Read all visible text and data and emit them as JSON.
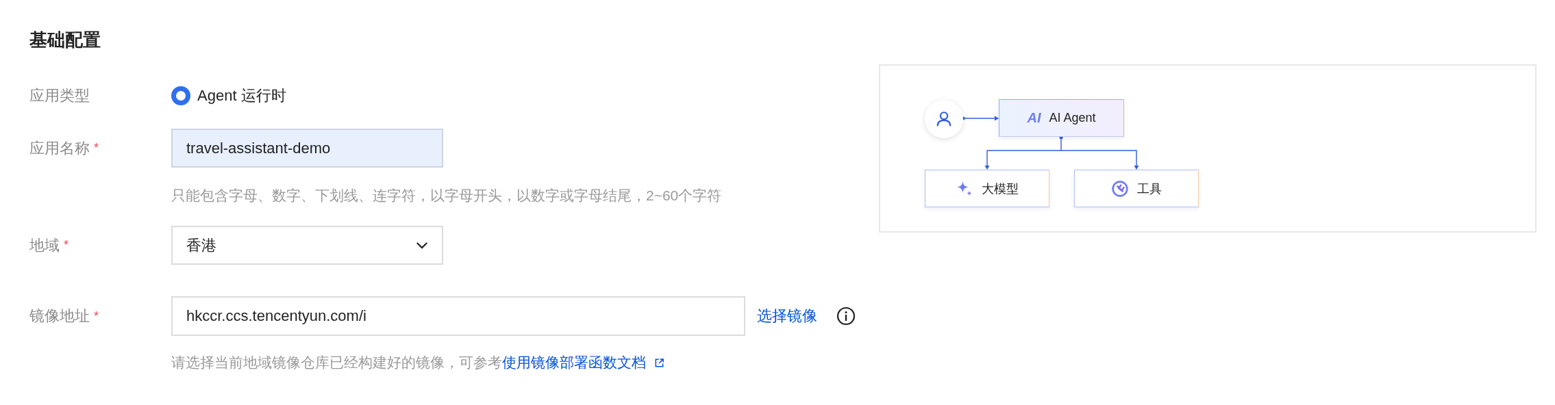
{
  "section_title": "基础配置",
  "fields": [
    {
      "kind": "radio",
      "label": "应用类型",
      "options": [
        {
          "label": "Agent 运行时",
          "selected": true
        }
      ]
    },
    {
      "kind": "text",
      "label": "应用名称",
      "mark": "*",
      "value": "travel-assistant-demo",
      "autofilled": true,
      "hint": "只能包含字母、数字、下划线、连字符，以字母开头，以数字或字母结尾，2~60个字符"
    },
    {
      "kind": "select",
      "label": "地域",
      "mark": "*",
      "value": "香港"
    },
    {
      "kind": "text",
      "label": "镜像地址",
      "mark": "*",
      "value": "hkccr.ccs.tencentyun.com/i",
      "autofilled": false,
      "link": "选择镜像",
      "info": true,
      "hint": "请选择当前地域镜像仓库已经构建好的镜像，可参考",
      "hint_link": "使用镜像部署函数文档"
    }
  ],
  "diagram": {
    "agent": {
      "badge": "AI",
      "label": "AI Agent"
    },
    "children": [
      {
        "kind": "model",
        "label": "大模型"
      },
      {
        "kind": "tool",
        "label": "工具"
      }
    ]
  }
}
